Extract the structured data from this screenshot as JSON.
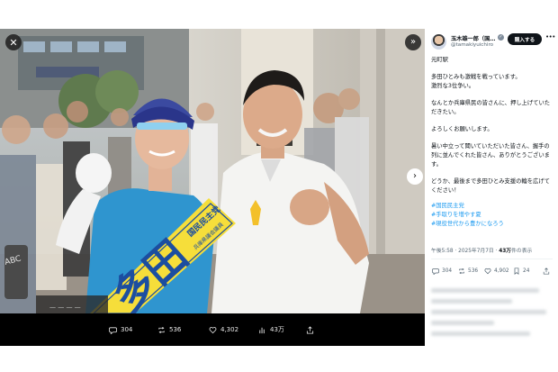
{
  "viewer": {
    "close_icon": "close-icon",
    "expand_icon": "expand-icon",
    "next_icon": "chevron-right-icon",
    "photo": {
      "sash_text_top": "国民民主党",
      "sash_text_mid": "兵庫県議会議員",
      "sash_text_big": "多田",
      "sash_text_small": "ひとみ",
      "overlay_text": "一 一 一 一"
    },
    "actions": {
      "replies": "304",
      "reposts": "536",
      "likes": "4,302",
      "views": "43万"
    }
  },
  "post": {
    "author_name": "玉木雄一郎（国…",
    "author_handle": "@tamakiyuichiro",
    "subscribe_label": "購入する",
    "more_label": "•••",
    "paragraphs": [
      "元町駅",
      "多田ひとみも激戦を戦っています。\n激烈な3位争い。",
      "なんとか兵庫県民の皆さんに、押し上げていただきたい。",
      "よろしくお願いします。",
      "暑い中立って聞いていただいた皆さん、握手の列に並んでくれた皆さん、ありがとうございます。",
      "どうか、最後まで多田ひとみ支援の輪を広げてください！"
    ],
    "hashtags": [
      "#国民民主党",
      "#手取りを増やす夏",
      "#現役世代から豊かになろう"
    ],
    "time": "午後5:58",
    "date": "2025年7月7日",
    "views_count": "43万",
    "views_label": "件の表示",
    "actions": {
      "replies": "304",
      "reposts": "536",
      "likes": "4,902",
      "bookmarks": "24"
    }
  },
  "colors": {
    "accent": "#1d9bf0",
    "text": "#0f1419",
    "muted": "#536471",
    "viewer_bg": "#000000"
  }
}
